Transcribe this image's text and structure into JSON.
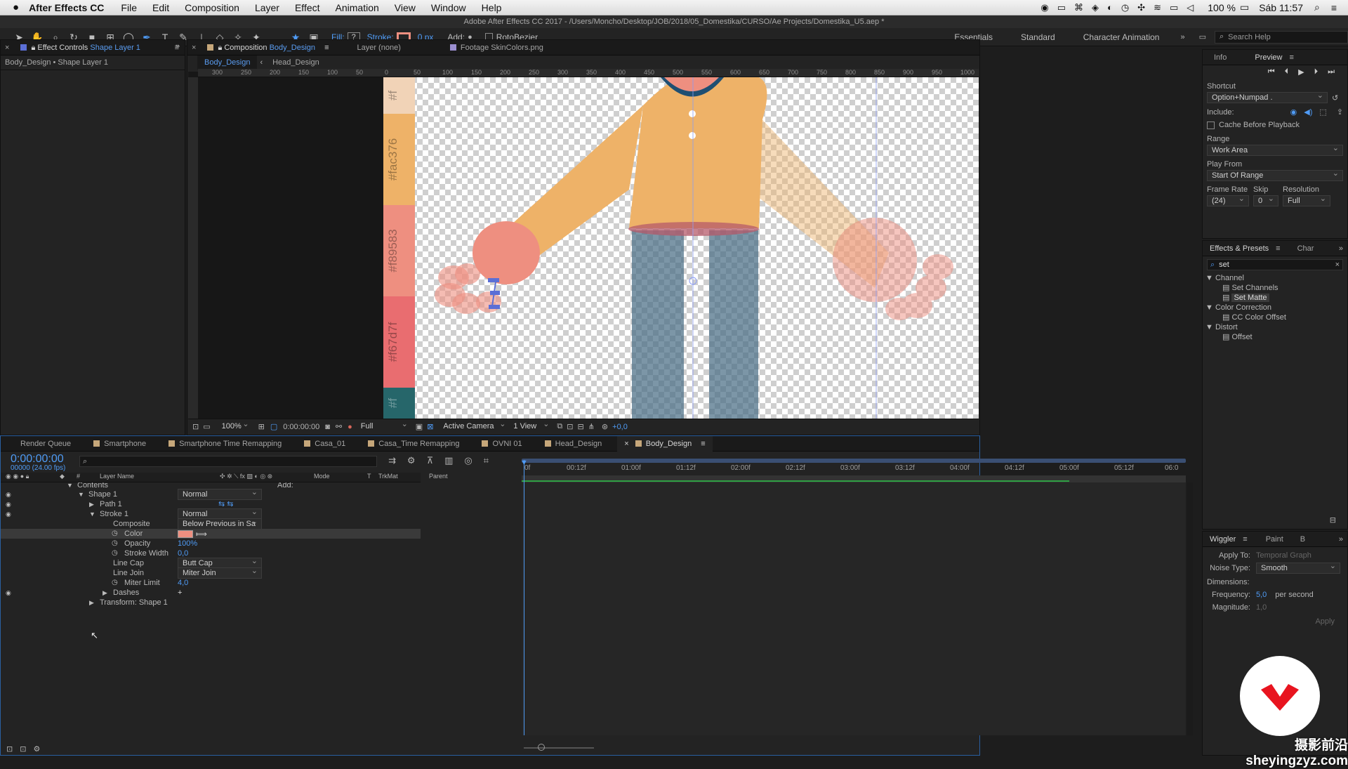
{
  "menubar": {
    "app": "After Effects CC",
    "items": [
      "File",
      "Edit",
      "Composition",
      "Layer",
      "Effect",
      "Animation",
      "View",
      "Window",
      "Help"
    ],
    "status": {
      "battery": "100 %",
      "clock": "Sáb 11:57"
    }
  },
  "window_title": "Adobe After Effects CC 2017 - /Users/Moncho/Desktop/JOB/2018/05_Domestika/CURSO/Ae Projects/Domestika_U5.aep *",
  "toolbar": {
    "fill_label": "Fill:",
    "stroke_label": "Stroke:",
    "stroke_width": "0 px",
    "add_label": "Add:",
    "rotobezier": "RotoBezier",
    "workspaces": [
      "Essentials",
      "Standard",
      "Character Animation"
    ],
    "search_placeholder": "Search Help"
  },
  "effect_controls": {
    "tab_prefix": "Effect Controls",
    "tab_layer": "Shape Layer 1",
    "subtitle": "Body_Design • Shape Layer 1"
  },
  "viewer": {
    "tabs": [
      {
        "prefix": "Composition",
        "name": "Body_Design"
      },
      {
        "name": "Layer (none)"
      },
      {
        "name": "Footage SkinColors.png"
      }
    ],
    "subtabs": [
      "Body_Design",
      "Head_Design"
    ],
    "ruler_labels": [
      "300",
      "250",
      "200",
      "150",
      "100",
      "50",
      "0",
      "50",
      "100",
      "150",
      "200",
      "250",
      "300",
      "350",
      "400",
      "450",
      "500",
      "550",
      "600",
      "650",
      "700",
      "750",
      "800",
      "850",
      "900",
      "950",
      "1000"
    ],
    "swatches": [
      {
        "label": "#f",
        "color": "#f1d3b7"
      },
      {
        "label": "#fac376",
        "color": "#eeb268"
      },
      {
        "label": "#f89583",
        "color": "#ee8f80"
      },
      {
        "label": "#f67d7f",
        "color": "#e96d70"
      },
      {
        "label": "#f",
        "color": "#26666a"
      }
    ],
    "footer": {
      "zoom": "100%",
      "timecode": "0:00:00:00",
      "resolution": "Full",
      "camera": "Active Camera",
      "views": "1 View",
      "exposure": "+0,0"
    }
  },
  "timeline": {
    "tabs": [
      "Render Queue",
      "Smartphone",
      "Smartphone Time Remapping",
      "Casa_01",
      "Casa_Time Remapping",
      "OVNI 01",
      "Head_Design",
      "Body_Design"
    ],
    "timecode": "0:00:00:00",
    "frame_info": "00000 (24.00 fps)",
    "headers": {
      "layer_name": "Layer Name",
      "mode": "Mode",
      "t": "T",
      "trkmat": "TrkMat",
      "parent": "Parent",
      "hash": "#"
    },
    "ruler": [
      "0f",
      "00:12f",
      "01:00f",
      "01:12f",
      "02:00f",
      "02:12f",
      "03:00f",
      "03:12f",
      "04:00f",
      "04:12f",
      "05:00f",
      "05:12f",
      "06:0"
    ],
    "rows": [
      {
        "name": "Contents",
        "value": "Add:"
      },
      {
        "name": "Shape 1",
        "value": "Normal"
      },
      {
        "name": "Path 1",
        "value": ""
      },
      {
        "name": "Stroke 1",
        "value": "Normal"
      },
      {
        "name": "Composite",
        "value": "Below Previous in Sa"
      },
      {
        "name": "Color",
        "value": ""
      },
      {
        "name": "Opacity",
        "value": "100%"
      },
      {
        "name": "Stroke Width",
        "value": "0,0"
      },
      {
        "name": "Line Cap",
        "value": "Butt Cap"
      },
      {
        "name": "Line Join",
        "value": "Miter Join"
      },
      {
        "name": "Miter Limit",
        "value": "4,0"
      },
      {
        "name": "Dashes",
        "value": "+"
      },
      {
        "name": "Transform: Shape 1",
        "value": ""
      }
    ]
  },
  "preview": {
    "tabs": [
      "Info",
      "Preview"
    ],
    "shortcut_label": "Shortcut",
    "shortcut": "Option+Numpad .",
    "include_label": "Include:",
    "cache": "Cache Before Playback",
    "range_label": "Range",
    "range": "Work Area",
    "play_from_label": "Play From",
    "play_from": "Start Of Range",
    "frame_rate_label": "Frame Rate",
    "skip_label": "Skip",
    "resolution_label": "Resolution",
    "frame_rate": "(24)",
    "skip": "0",
    "resolution": "Full"
  },
  "effects": {
    "tabs": [
      "Effects & Presets",
      "Char"
    ],
    "search": "set",
    "groups": [
      {
        "name": "Channel",
        "items": [
          "Set Channels",
          "Set Matte"
        ]
      },
      {
        "name": "Color Correction",
        "items": [
          "CC Color Offset"
        ]
      },
      {
        "name": "Distort",
        "items": [
          "Offset"
        ]
      }
    ]
  },
  "wiggler": {
    "tabs": [
      "Wiggler",
      "Paint",
      "B"
    ],
    "apply_to_label": "Apply To:",
    "apply_to": "Temporal Graph",
    "noise_label": "Noise Type:",
    "noise": "Smooth",
    "dimensions_label": "Dimensions:",
    "frequency_label": "Frequency:",
    "frequency": "5,0",
    "per_second": "per second",
    "magnitude_label": "Magnitude:",
    "magnitude": "1,0",
    "apply": "Apply"
  },
  "watermark": "摄影前沿 sheyingzyz.com",
  "colors": {
    "accent": "#4f9bf5",
    "stroke_swatch": "#ee8f80",
    "sweater": "#eeb268",
    "pants": "#4a6f86",
    "skin": "#ee8f80"
  }
}
